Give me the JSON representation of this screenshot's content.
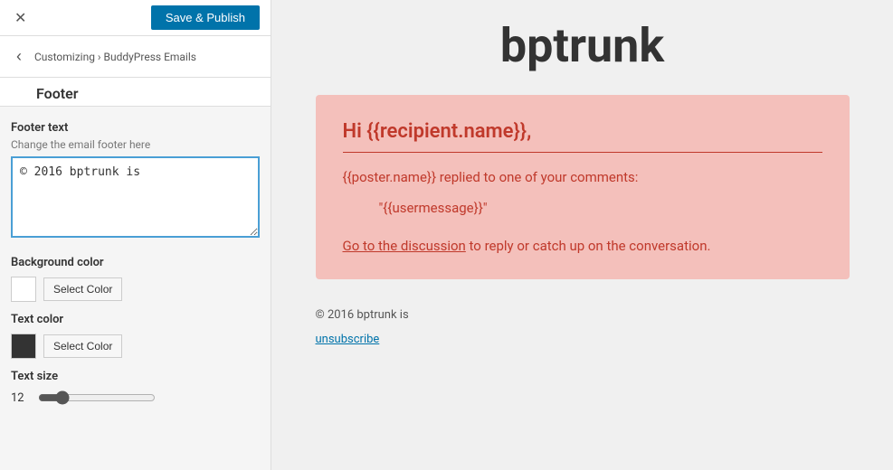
{
  "topBar": {
    "closeLabel": "✕",
    "savePublishLabel": "Save & Publish"
  },
  "nav": {
    "backLabel": "‹",
    "breadcrumb": "Customizing › BuddyPress Emails",
    "title": "Footer"
  },
  "footerText": {
    "sectionLabel": "Footer text",
    "hint": "Change the email footer here",
    "value": "© 2016 bptrunk is"
  },
  "backgroundColorSection": {
    "label": "Background color",
    "selectLabel": "Select Color",
    "swatchColor": "white"
  },
  "textColorSection": {
    "label": "Text color",
    "selectLabel": "Select Color",
    "swatchColor": "dark"
  },
  "textSizeSection": {
    "label": "Text size",
    "value": "12",
    "sliderMin": "8",
    "sliderMax": "32",
    "sliderValue": "12"
  },
  "preview": {
    "siteTitle": "bptrunk",
    "emailCard": {
      "greeting": "Hi {{recipient.name}},",
      "bodyText": "{{poster.name}} replied to one of your comments:",
      "quoteText": "\"{{usermessage}}\"",
      "ctaText": " to reply or catch up on the conversation.",
      "ctaLinkText": "Go to the discussion"
    },
    "footer": {
      "text": "© 2016 bptrunk is",
      "unsubscribeLabel": "unsubscribe"
    }
  }
}
